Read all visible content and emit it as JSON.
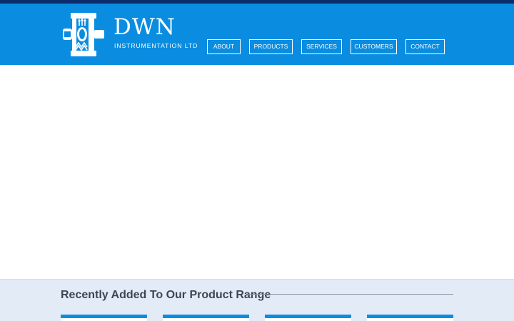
{
  "brand": {
    "name": "DWN",
    "subtitle": "INSTRUMENTATION LTD"
  },
  "icons": {
    "logo": "instrumentation-valve-logo-icon"
  },
  "nav": {
    "items": [
      {
        "label": "ABOUT"
      },
      {
        "label": "PRODUCTS"
      },
      {
        "label": "SERVICES"
      },
      {
        "label": "CUSTOMERS"
      },
      {
        "label": "CONTACT"
      }
    ]
  },
  "products": {
    "title": "Recently Added To Our Product Range",
    "cards": [
      {},
      {},
      {},
      {}
    ]
  },
  "colors": {
    "top_stripe": "#0b2d6b",
    "header": "#0a8de0",
    "products_band": "#e3ebf7",
    "card_accent": "#0a8de0",
    "title_text": "#3a4752"
  }
}
